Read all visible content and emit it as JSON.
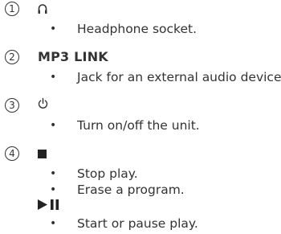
{
  "items": [
    {
      "number": "1",
      "icon": "headphone-icon",
      "bullets": [
        "Headphone socket."
      ]
    },
    {
      "number": "2",
      "heading": "MP3 LINK",
      "bullets": [
        "Jack for an external audio device."
      ]
    },
    {
      "number": "3",
      "icon": "power-icon",
      "bullets": [
        "Turn on/off the unit."
      ]
    },
    {
      "number": "4",
      "icon": "stop-icon",
      "bullets": [
        "Stop play.",
        "Erase a program."
      ],
      "sub": {
        "icon": "play-pause-icon",
        "bullets": [
          "Start or pause play."
        ]
      }
    }
  ],
  "bullet_symbol": "•"
}
